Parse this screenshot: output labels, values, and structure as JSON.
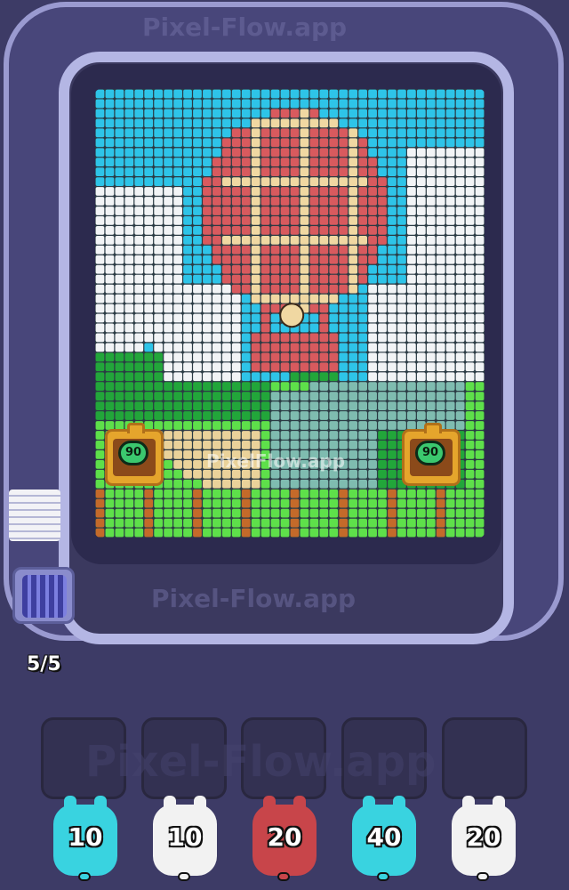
{
  "watermark": "Pixel-Flow.app",
  "board_watermark": "PixelFlow.app",
  "shooters": [
    {
      "value": "90",
      "icon": "pig-shooter-icon"
    },
    {
      "value": "90",
      "icon": "pig-shooter-icon"
    }
  ],
  "counter": "5/5",
  "slots_watermark": "Pixel-Flow.app",
  "queue": [
    {
      "value": "10",
      "color": "#39d3e0"
    },
    {
      "value": "10",
      "color": "#f2f2f2"
    },
    {
      "value": "20",
      "color": "#c8454a"
    },
    {
      "value": "40",
      "color": "#39d3e0"
    },
    {
      "value": "20",
      "color": "#f2f2f2"
    }
  ],
  "palette": {
    "sky": "#2ec4e8",
    "cloud": "#f2f4f6",
    "balloon_red": "#d85a5e",
    "balloon_cream": "#f0d8a2",
    "grass_green": "#22a63a",
    "light_green": "#5ee04a",
    "hill_teal": "#7fbcb0",
    "path_sand": "#ead29a",
    "stump": "#c46a2a"
  }
}
